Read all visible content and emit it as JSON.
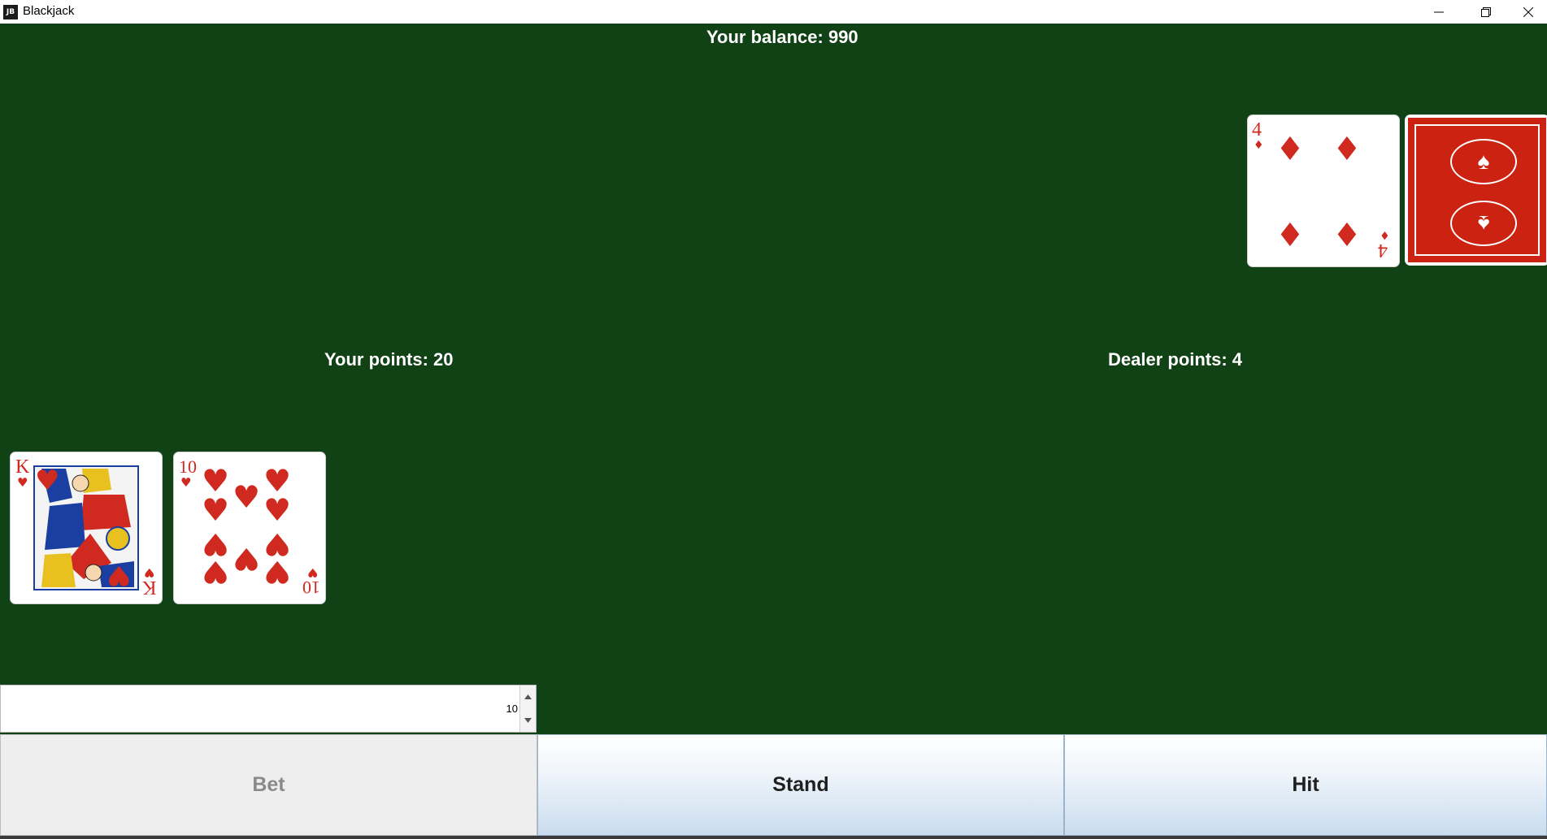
{
  "window": {
    "title": "Blackjack",
    "icon_text": "JB"
  },
  "table": {
    "background": "#114216"
  },
  "balance_label": "Your balance: 990",
  "player": {
    "points_label": "Your points: 20",
    "cards": [
      {
        "rank": "K",
        "suit": "♥",
        "face": "king-of-hearts"
      },
      {
        "rank": "10",
        "suit": "♥",
        "face": "ten-of-hearts"
      }
    ]
  },
  "dealer": {
    "points_label": "Dealer points: 4",
    "cards": [
      {
        "rank": "4",
        "suit": "♦",
        "face": "four-of-diamonds"
      },
      {
        "rank": "",
        "suit": "",
        "face": "face-down-card-back"
      }
    ]
  },
  "bet": {
    "value": "10"
  },
  "buttons": {
    "bet": "Bet",
    "stand": "Stand",
    "hit": "Hit"
  },
  "colors": {
    "card_red": "#d0291f",
    "card_back": "#cc2211"
  }
}
